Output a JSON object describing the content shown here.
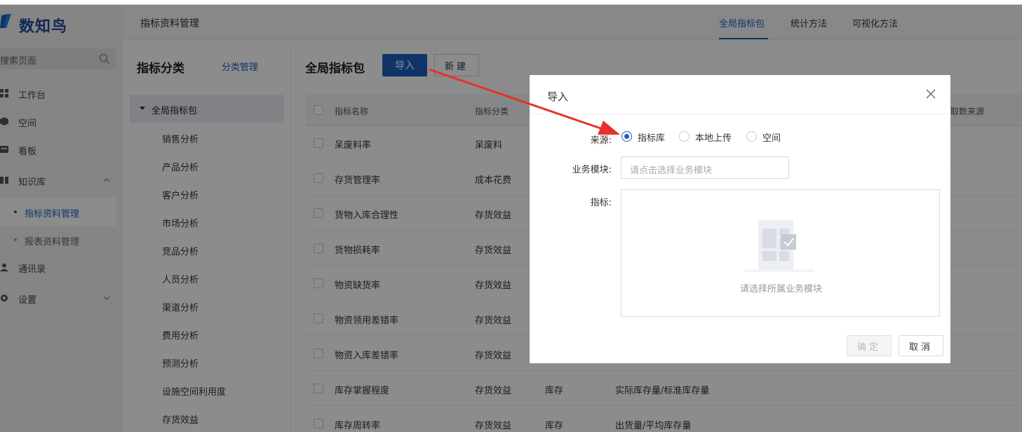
{
  "app": {
    "logo_text": "数知鸟"
  },
  "sidebar": {
    "search_placeholder": "搜索页面",
    "items": [
      {
        "label": "工作台",
        "icon": "grid-icon"
      },
      {
        "label": "空间",
        "icon": "cube-icon"
      },
      {
        "label": "看板",
        "icon": "board-icon"
      },
      {
        "label": "知识库",
        "icon": "book-icon"
      },
      {
        "label": "通讯录",
        "icon": "user-icon"
      },
      {
        "label": "设置",
        "icon": "gear-icon"
      }
    ],
    "sub_items": [
      {
        "label": "指标资料管理",
        "active": true
      },
      {
        "label": "报表资料管理",
        "active": false
      }
    ]
  },
  "header": {
    "title": "指标资料管理",
    "tabs": [
      {
        "label": "全局指标包",
        "active": true
      },
      {
        "label": "统计方法",
        "active": false
      },
      {
        "label": "可视化方法",
        "active": false
      }
    ]
  },
  "category": {
    "title": "指标分类",
    "manage_label": "分类管理",
    "root": "全局指标包",
    "items": [
      "销售分析",
      "产品分析",
      "客户分析",
      "市场分析",
      "竞品分析",
      "人员分析",
      "渠道分析",
      "费用分析",
      "预测分析",
      "设施空间利用度",
      "存货效益"
    ]
  },
  "main": {
    "title": "全局指标包",
    "import_label": "导入",
    "new_label": "新建",
    "columns": [
      "指标名称",
      "指标分类",
      "取数来源"
    ],
    "rows": [
      {
        "name": "呆废料率",
        "category": "呆废料",
        "c3": "",
        "c4": ""
      },
      {
        "name": "存货管理率",
        "category": "成本花费",
        "c3": "",
        "c4": ""
      },
      {
        "name": "货物入库合理性",
        "category": "存货效益",
        "c3": "",
        "c4": ""
      },
      {
        "name": "货物损耗率",
        "category": "存货效益",
        "c3": "",
        "c4": ""
      },
      {
        "name": "物资缺货率",
        "category": "存货效益",
        "c3": "",
        "c4": ""
      },
      {
        "name": "物资领用差错率",
        "category": "存货效益",
        "c3": "",
        "c4": ""
      },
      {
        "name": "物资入库差错率",
        "category": "存货效益",
        "c3": "",
        "c4": ""
      },
      {
        "name": "库存掌握程度",
        "category": "存货效益",
        "c3": "库存",
        "c4": "实际库存量/标准库存量"
      },
      {
        "name": "库存周转率",
        "category": "存货效益",
        "c3": "库存",
        "c4": "出货量/平均库存量"
      }
    ]
  },
  "dialog": {
    "title": "导入",
    "source_label": "来源:",
    "source_options": [
      {
        "label": "指标库",
        "checked": true
      },
      {
        "label": "本地上传",
        "checked": false
      },
      {
        "label": "空间",
        "checked": false
      }
    ],
    "module_label": "业务模块:",
    "module_placeholder": "请点击选择业务模块",
    "metric_label": "指标:",
    "empty_text": "请选择所属业务模块",
    "ok_label": "确定",
    "cancel_label": "取消"
  },
  "colors": {
    "accent": "#1e5fc0",
    "annotation_arrow": "#e8302a"
  }
}
